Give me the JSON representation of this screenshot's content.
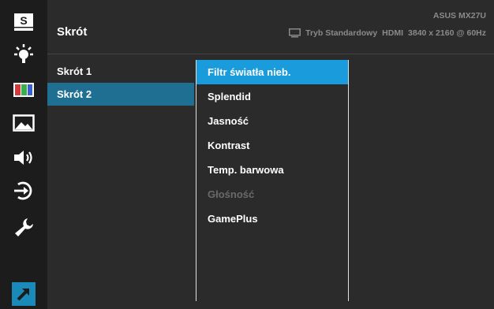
{
  "model": "ASUS MX27U",
  "header": {
    "title": "Skrót",
    "mode": "Tryb Standardowy",
    "input": "HDMI",
    "resolution": "3840 x 2160 @ 60Hz"
  },
  "sidebar": {
    "items": [
      {
        "icon": "splendid-s-icon"
      },
      {
        "icon": "blue-light-filter-icon"
      },
      {
        "icon": "color-bars-icon"
      },
      {
        "icon": "image-icon"
      },
      {
        "icon": "sound-icon"
      },
      {
        "icon": "input-select-icon"
      },
      {
        "icon": "system-setup-wrench-icon"
      },
      {
        "icon": "shortcut-arrow-icon"
      }
    ],
    "active_index": 7
  },
  "shortcuts": [
    {
      "label": "Skrót 1"
    },
    {
      "label": "Skrót 2"
    }
  ],
  "options": [
    {
      "label": "Filtr światła nieb."
    },
    {
      "label": "Splendid"
    },
    {
      "label": "Jasność"
    },
    {
      "label": "Kontrast"
    },
    {
      "label": "Temp. barwowa"
    },
    {
      "label": "Głośność"
    },
    {
      "label": "GamePlus"
    }
  ],
  "colors": {
    "highlight": "#1a9bdc",
    "selected": "#1f6f93",
    "active_icon_bg": "#1a8ab8"
  }
}
